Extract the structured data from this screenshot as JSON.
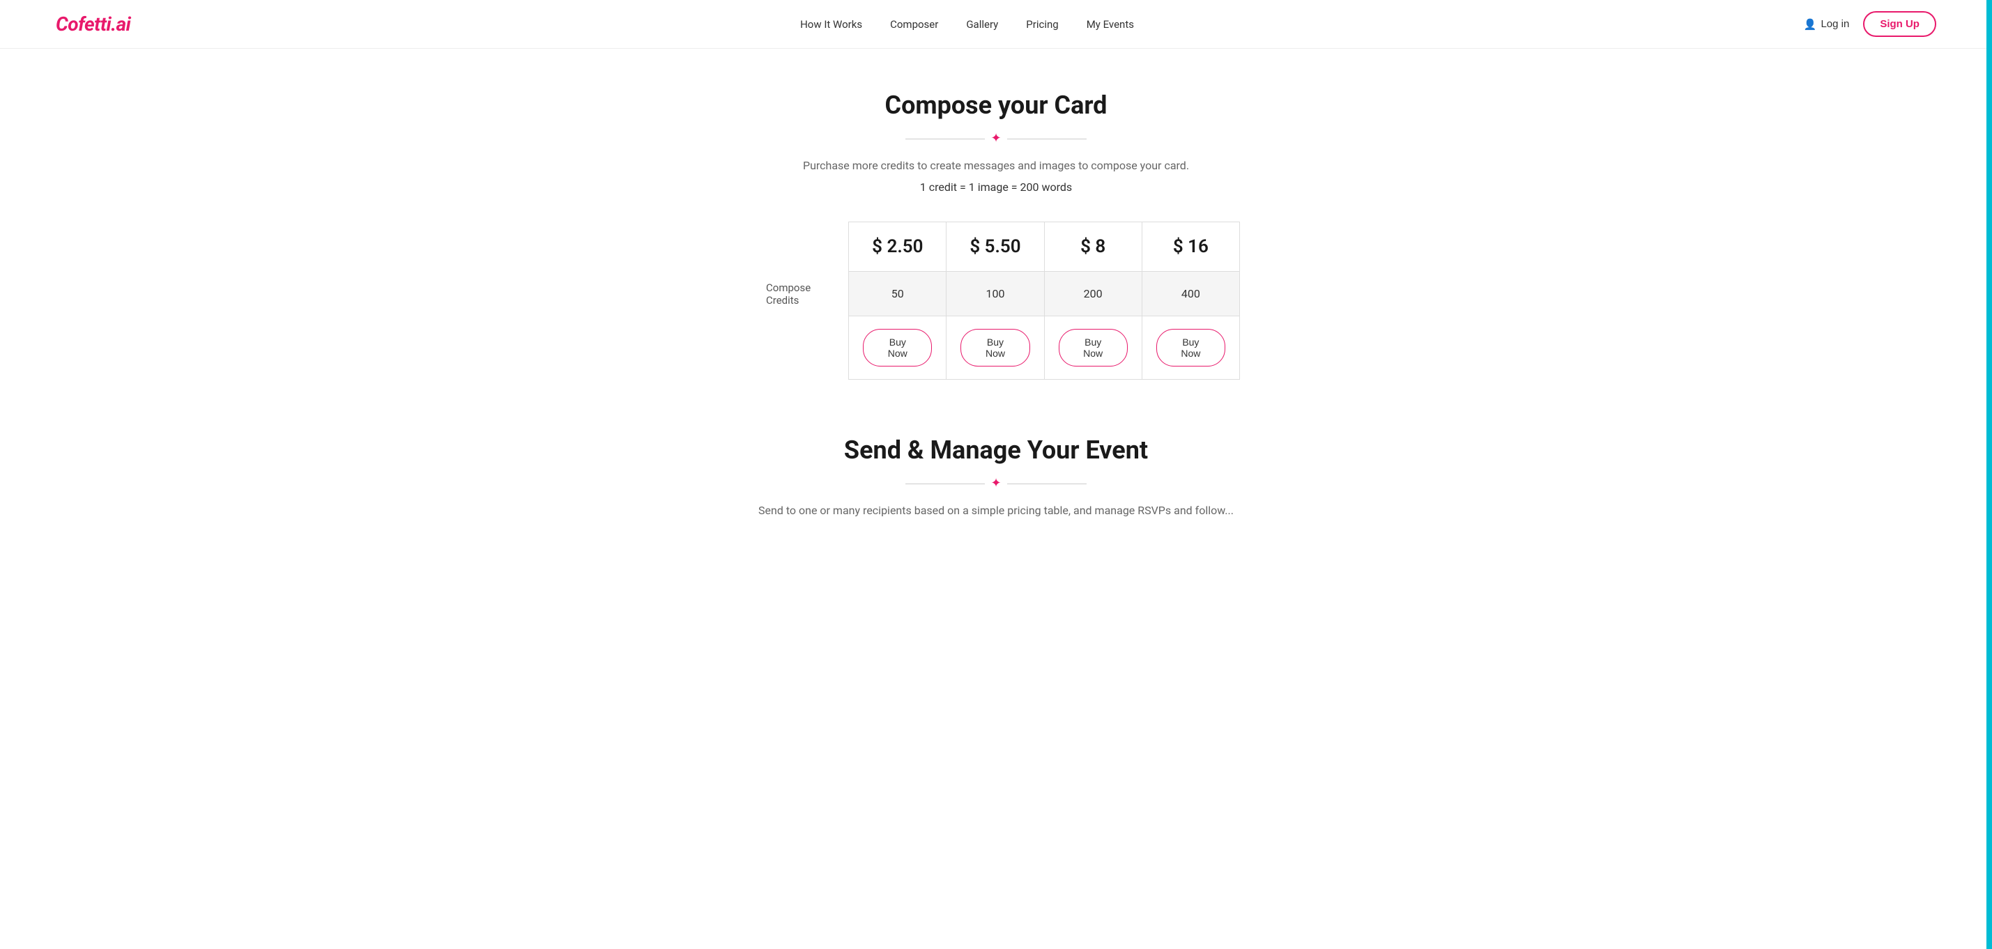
{
  "brand": {
    "name": "Cofetti.ai"
  },
  "nav": {
    "links": [
      {
        "label": "How It Works",
        "id": "how-it-works"
      },
      {
        "label": "Composer",
        "id": "composer"
      },
      {
        "label": "Gallery",
        "id": "gallery"
      },
      {
        "label": "Pricing",
        "id": "pricing"
      },
      {
        "label": "My Events",
        "id": "my-events"
      }
    ],
    "login_label": "Log in",
    "signup_label": "Sign Up"
  },
  "compose_card_section": {
    "title": "Compose your Card",
    "subtitle": "Purchase more credits to create messages and images to compose your card.",
    "credit_info": "1 credit = 1 image = 200 words",
    "pricing_tiers": [
      {
        "price": "$ 2.50",
        "credits": "50"
      },
      {
        "price": "$ 5.50",
        "credits": "100"
      },
      {
        "price": "$ 8",
        "credits": "200"
      },
      {
        "price": "$ 16",
        "credits": "400"
      }
    ],
    "row_label": "Compose Credits",
    "buy_now_label": "Buy Now"
  },
  "send_manage_section": {
    "title": "Send & Manage Your Event",
    "subtitle": "Send to one or many recipients based on a simple pricing table, and manage RSVPs and follow..."
  }
}
